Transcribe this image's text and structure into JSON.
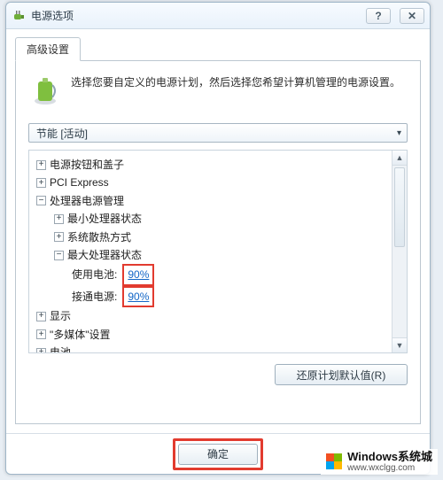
{
  "window": {
    "title": "电源选项"
  },
  "tabs": {
    "advanced": "高级设置"
  },
  "intro": {
    "text": "选择您要自定义的电源计划，然后选择您希望计算机管理的电源设置。"
  },
  "plan_select": {
    "value": "节能 [活动]"
  },
  "tree": {
    "power_buttons_lid": "电源按钮和盖子",
    "pci_express": "PCI Express",
    "processor_power_mgmt": "处理器电源管理",
    "min_proc_state": "最小处理器状态",
    "cooling_policy": "系统散热方式",
    "max_proc_state": "最大处理器状态",
    "on_battery_label": "使用电池:",
    "on_battery_value": "90%",
    "plugged_in_label": "接通电源:",
    "plugged_in_value": "90%",
    "display": "显示",
    "multimedia": "\"多媒体\"设置",
    "battery": "电池"
  },
  "buttons": {
    "restore_defaults": "还原计划默认值(R)",
    "ok": "确定"
  },
  "watermark": {
    "line1": "Windows系统城",
    "line2": "www.wxclgg.com"
  }
}
